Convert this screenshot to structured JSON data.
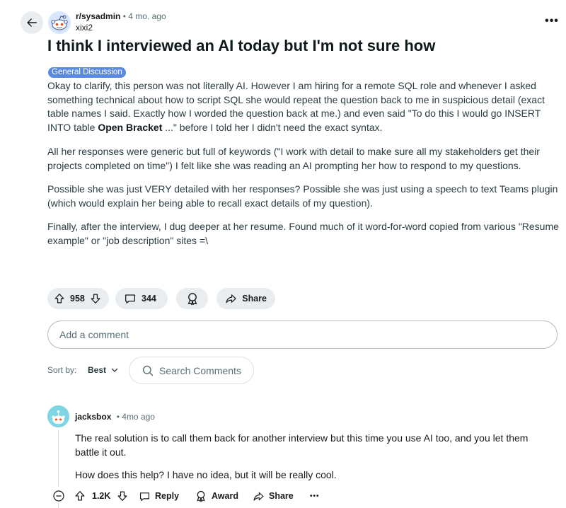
{
  "header": {
    "subreddit": "r/sysadmin",
    "separator": "•",
    "age": "4 mo. ago",
    "author": "xixi2",
    "overflow_label": "•••"
  },
  "post": {
    "title": "I think I interviewed an AI today but I'm not sure how",
    "flair": "General Discussion",
    "p1_before": "Okay to clarify, this person was not literally AI. However I am hiring for a remote SQL role and whenever I asked something technical about how to script SQL she would repeat the question back to me in suspicious detail (exact table names I said. Exactly how I worded the question back at me.) and even said \"To do this I would go INSERT INTO table ",
    "p1_bold": "Open Bracket",
    "p1_after": " ...\" before I told her I didn't need the exact syntax.",
    "p2": "All her responses were generic but full of keywords (\"I work with detail to make sure all my stakeholders get their projects completed on time\") I felt like she was reading an AI prompting her how to respond to my questions.",
    "p3": "Possible she was just VERY detailed with her responses? Possible she was just using a speech to text Teams plugin (which would explain her being able to recall exact details of my question).",
    "p4": "Finally, after the interview, I dug deeper at her resume. Found much of it word-for-word copied from various \"Resume example\" or \"job description\" sites =\\"
  },
  "actions": {
    "votes": "958",
    "comments": "344",
    "share_label": "Share"
  },
  "comment_input": {
    "placeholder": "Add a comment"
  },
  "sort": {
    "label": "Sort by:",
    "value": "Best",
    "search_placeholder": "Search Comments"
  },
  "comment": {
    "author": "jacksbox",
    "separator": "•",
    "age": "4mo ago",
    "p1": "The real solution is to call them back for another interview but this time you use AI too, and you let them battle it out.",
    "p2": "How does this help? I have no idea, but it will be really cool.",
    "votes": "1.2K",
    "reply_label": "Reply",
    "award_label": "Award",
    "share_label": "Share",
    "more_label": "•••"
  },
  "colors": {
    "flair_bg": "#5a8ae0",
    "pill_bg": "#eaedef",
    "text_primary": "#1a1a1b",
    "text_muted": "#576f76"
  }
}
